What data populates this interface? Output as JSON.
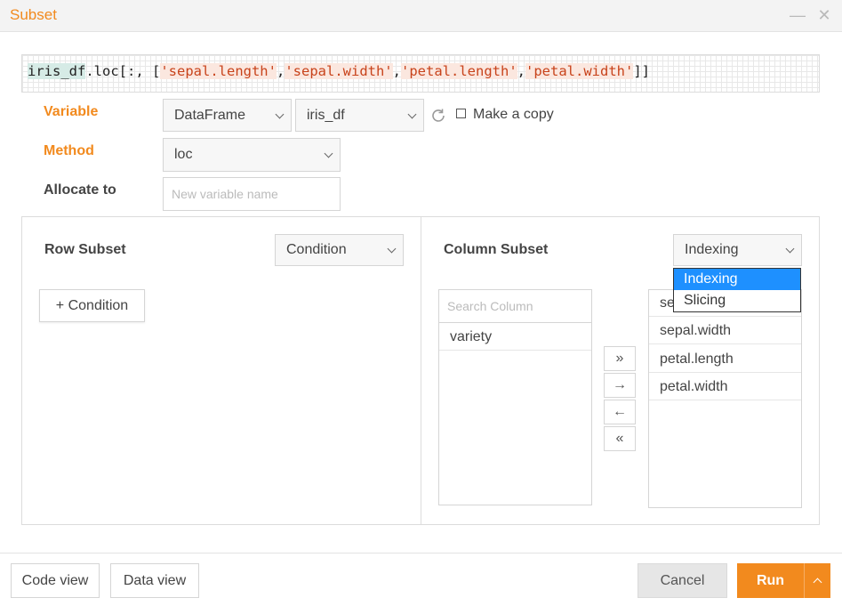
{
  "window": {
    "title": "Subset",
    "minimize_icon": "minimize-icon",
    "close_icon": "close-icon"
  },
  "code": {
    "var": "iris_df",
    "prefix": ".loc[:, [",
    "strings": [
      "'sepal.length'",
      "'sepal.width'",
      "'petal.length'",
      "'petal.width'"
    ],
    "separator": ",",
    "suffix": "]]"
  },
  "form": {
    "variable_label": "Variable",
    "variable_type": "DataFrame",
    "variable_name": "iris_df",
    "make_copy_label": "Make a copy",
    "make_copy_checked": false,
    "method_label": "Method",
    "method_value": "loc",
    "allocate_label": "Allocate to",
    "allocate_placeholder": "New variable name"
  },
  "row_subset": {
    "title": "Row Subset",
    "mode": "Condition",
    "add_button": "+ Condition"
  },
  "column_subset": {
    "title": "Column Subset",
    "mode": "Indexing",
    "dropdown_options": [
      "Indexing",
      "Slicing"
    ],
    "search_placeholder": "Search Column",
    "available": [
      "variety"
    ],
    "selected_first_visible": "se",
    "selected": [
      "sepal.width",
      "petal.length",
      "petal.width"
    ],
    "move_buttons": [
      "»",
      "→",
      "←",
      "«"
    ]
  },
  "footer": {
    "code_view": "Code view",
    "data_view": "Data view",
    "cancel": "Cancel",
    "run": "Run"
  },
  "colors": {
    "accent": "#f28a1e",
    "highlight": "#1e90ff"
  }
}
